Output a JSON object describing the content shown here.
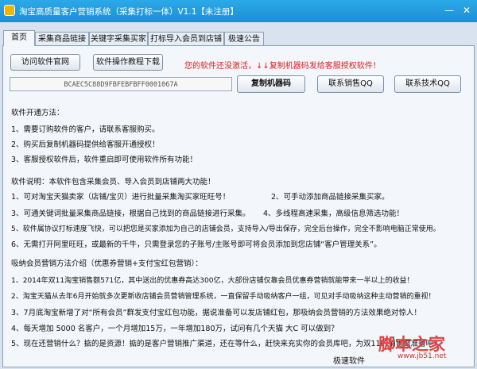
{
  "window": {
    "title": "淘宝高质量客户营销系统（采集打标一体）V1.1【未注册】",
    "minimize": "—",
    "close": "✕"
  },
  "tabs": [
    "首页",
    "采集商品链接",
    "关键字采集买家",
    "打标导入会员到店铺",
    "极速公告"
  ],
  "toolbar": {
    "visit_site": "访问软件官网",
    "tutorial": "软件操作教程下载",
    "notice": "您的软件还没激活，↓↓复制机器码发给客服授权软件！",
    "machine_code": "BCAEC5C88D9FBFEBFBFF0001067A",
    "copy_code": "复制机器码",
    "contact_sales": "联系销售QQ",
    "contact_tech": "联系技术QQ"
  },
  "content": {
    "activation_title": "软件开通方法：",
    "activation": [
      "1、需要订购软件的客户，请联系客服购买。",
      "2、购买后复制机器码提供给客服开通授权！",
      "3、客服授权软件后，软件重启即可使用软件所有功能！"
    ],
    "desc_title": "软件说明：本软件包含采集会员、导入会员到店铺两大功能！",
    "desc": [
      "1、可对淘宝天猫卖家（店铺/宝贝）进行批量采集淘买家旺旺号！",
      "2、可手动添加商品链接采集买家。",
      "3、可通关键词批量采集商品链接，根据自己找到的商品链接进行采集。",
      "4、多线程高速采集，高级信息筛选功能！",
      "5、软件属协议打标速度飞快，可以把您是买家添加为自己的店铺会员，支持导入/导出保存，完全后台操作，完全不影响电脑正常使用。",
      "6、无需打开阿里旺旺，或最新的千牛，只需登录您的子账号/主账号即可将会员添加到您店铺“客户管理关系”。"
    ],
    "marketing_title": "吸纳会员营销方法介绍（优惠券营销+支付宝红包营销）：",
    "marketing": [
      "1、2014年双11淘宝销售额571亿，其中送出的优惠券高达300亿，大部份店铺仅靠会员优惠券营销就能带来一半以上的收益！",
      "2、淘宝天猫从去年6月开始就多次更新收店铺会员营销管理系统，一直保留手动吸纳客户一组，可见对手动吸纳这种主动营销的重视！",
      "3、7月底淘宝新增了对“所有会员”群发支付宝红包功能，据说准备可以发店铺红包，那吸纳会员营销的方法效果绝对惊人！",
      "4、每天增加 5000 名客户，一个月增加15万，一年增加180万，试问有几个天猫 大C 可以做到？",
      "5、现在还营销什么？掂的是资源！掂的是客户营销推广渠道，还在等什么，赶快来充实你的会员库吧，为双11的销售做准备吧！"
    ],
    "bottom_label": "极速软件"
  },
  "watermark": {
    "text": "脚本之家",
    "url": "www.jb51.net"
  }
}
